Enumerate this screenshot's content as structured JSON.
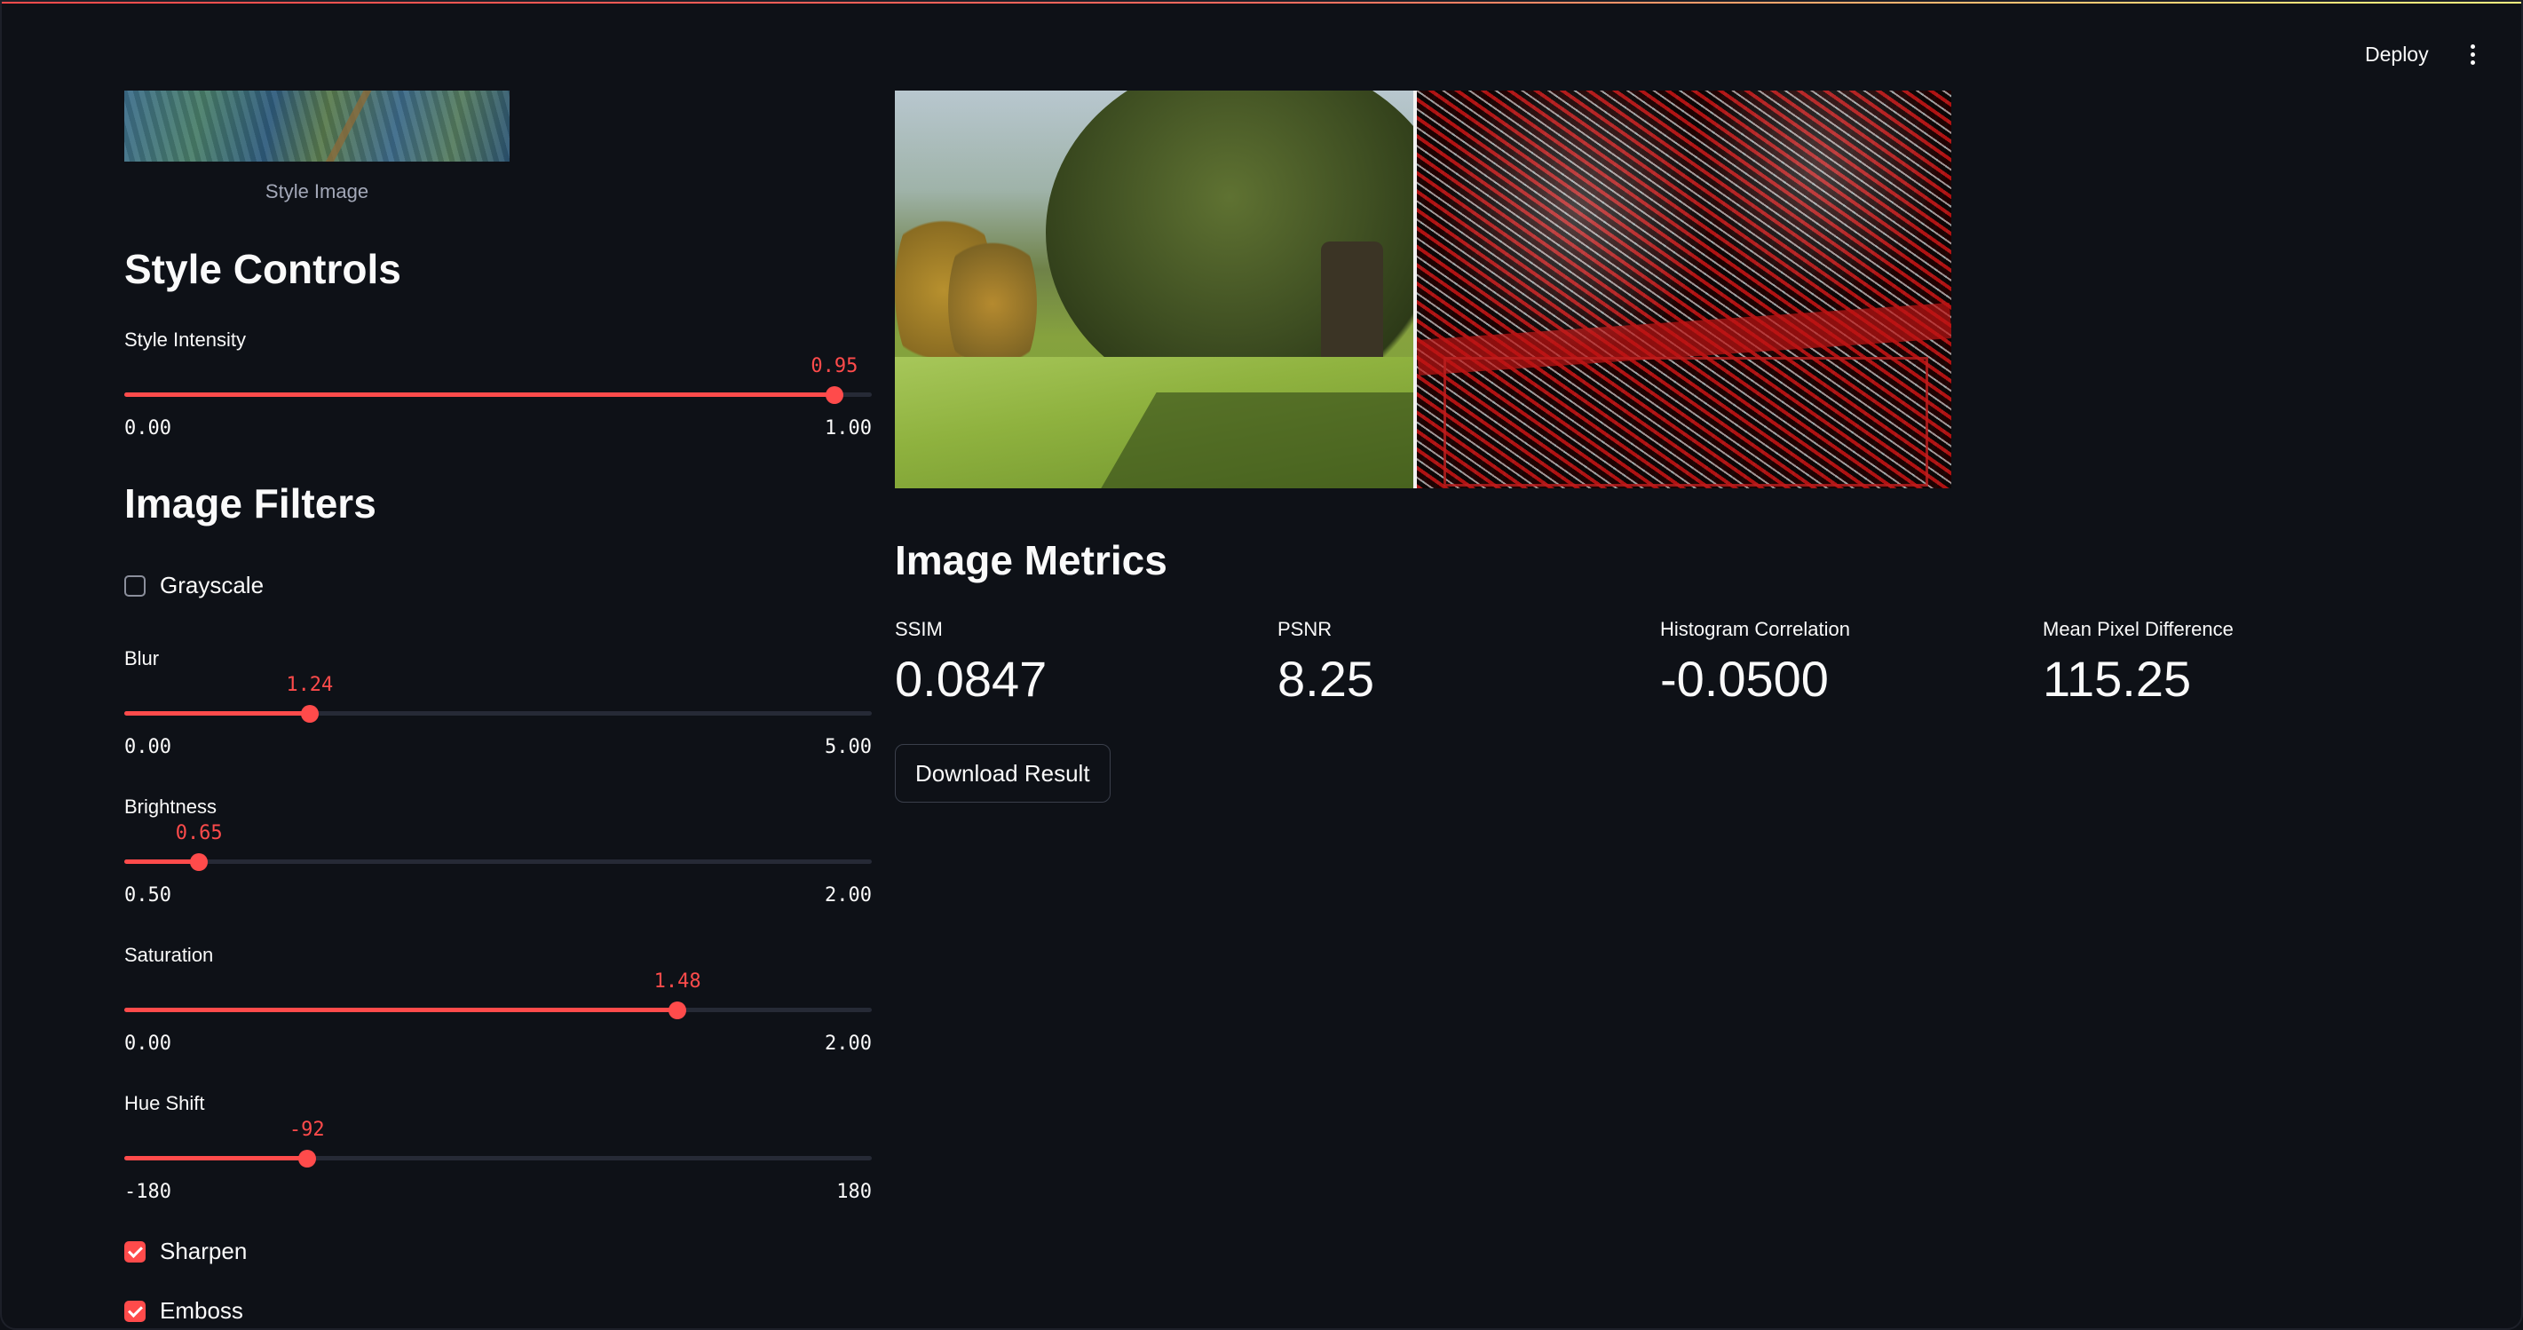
{
  "header": {
    "deploy_label": "Deploy",
    "menu_icon": "vertical-ellipsis-icon"
  },
  "sidebar": {
    "style_image_caption": "Style Image",
    "style_controls_title": "Style Controls",
    "style_intensity": {
      "label": "Style Intensity",
      "value": "0.95",
      "min": "0.00",
      "max": "1.00",
      "fraction": 0.95
    },
    "image_filters_title": "Image Filters",
    "grayscale": {
      "label": "Grayscale",
      "checked": false
    },
    "blur": {
      "label": "Blur",
      "value": "1.24",
      "min": "0.00",
      "max": "5.00",
      "fraction": 0.248
    },
    "brightness": {
      "label": "Brightness",
      "value": "0.65",
      "min": "0.50",
      "max": "2.00",
      "fraction": 0.1
    },
    "saturation": {
      "label": "Saturation",
      "value": "1.48",
      "min": "0.00",
      "max": "2.00",
      "fraction": 0.74
    },
    "hue_shift": {
      "label": "Hue Shift",
      "value": "-92",
      "min": "-180",
      "max": "180",
      "fraction": 0.2444
    },
    "sharpen": {
      "label": "Sharpen",
      "checked": true
    },
    "emboss": {
      "label": "Emboss",
      "checked": true
    }
  },
  "main": {
    "metrics_title": "Image Metrics",
    "metrics": [
      {
        "label": "SSIM",
        "value": "0.0847"
      },
      {
        "label": "PSNR",
        "value": "8.25"
      },
      {
        "label": "Histogram Correlation",
        "value": "-0.0500"
      },
      {
        "label": "Mean Pixel Difference",
        "value": "115.25"
      }
    ],
    "download_label": "Download Result"
  },
  "colors": {
    "accent": "#ff4b4b",
    "background": "#0e1117",
    "text": "#fafafa",
    "track": "#262a36"
  }
}
